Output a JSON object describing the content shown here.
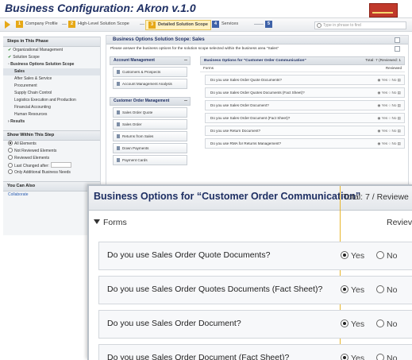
{
  "app": {
    "title": "Business Configuration: Akron v.1.0"
  },
  "steps": [
    {
      "num": "1",
      "label": "Company Profile"
    },
    {
      "num": "2",
      "label": "High-Level Solution Scope"
    },
    {
      "num": "3",
      "label": "Detailed Solution Scope"
    },
    {
      "num": "4",
      "label": "Services"
    },
    {
      "num": "5",
      "label": ""
    }
  ],
  "search": {
    "placeholder": "Type in phrase to find"
  },
  "sidebar": {
    "steps_title": "Steps in This Phase",
    "steps_items": [
      "Organizational Management",
      "Solution Scope",
      "Business Options Solution Scope",
      "Sales",
      "After Sales & Service",
      "Procurement",
      "Supply Chain Control",
      "Logistics Execution and Production",
      "Financial Accounting",
      "Human Resources",
      "Results"
    ],
    "show_title": "Show Within This Step",
    "show_items": [
      "All Elements",
      "Not Reviewed Elements",
      "Reviewed Elements",
      "Last Changed after:",
      "Only Additional Business Needs"
    ],
    "also_title": "You Can Also",
    "also_link": "Collaborate"
  },
  "main": {
    "title": "Business Options Solution Scope: Sales",
    "intro": "Please answer the business options for the solution scope selected within the business area \"Sales\"",
    "left_sections": [
      {
        "title": "Account Management",
        "items": [
          "Customers & Prospects",
          "Account Management Analysis"
        ]
      },
      {
        "title": "Customer Order Management",
        "items": [
          "Sales Order Quote",
          "Sales Order",
          "Returns from Sales",
          "Down Payments",
          "Payment Cards"
        ]
      }
    ],
    "panel_title": "Business Options for \"Customer Order Communication\"",
    "panel_total": "Total: 7 (Reviewed: 1",
    "panel_group": "Forms",
    "panel_reviewed": "Reviewed",
    "panel_rows": [
      "Do you use Sales Order Quote Documents?",
      "Do you use Sales Order Quotes Documents (Fact Sheet)?",
      "Do you use Sales Order Document?",
      "Do you use Sales Order Document (Fact Sheet)?",
      "Do you use Return Document?",
      "Do you use RMA for Returns Management?"
    ],
    "yes_label": "Yes",
    "no_label": "No"
  },
  "zoom": {
    "title": "Business Options for “Customer Order Communication”",
    "total": "Total: 7 / Reviewe",
    "group": "Forms",
    "reviewed": "Reviev",
    "rows": [
      {
        "question": "Do you use Sales Order Quote Documents?",
        "yes": "Yes",
        "no": "No"
      },
      {
        "question": "Do you use Sales Order Quotes Documents (Fact Sheet)?",
        "yes": "Yes",
        "no": "No"
      },
      {
        "question": "Do you use Sales Order Document?",
        "yes": "Yes",
        "no": "No"
      },
      {
        "question": "Do you use Sales Order Document (Fact Sheet)?",
        "yes": "Yes",
        "no": "No"
      }
    ]
  },
  "colors": {
    "accent": "#e6a817",
    "title": "#1e2f63",
    "link": "#2a5db0"
  }
}
